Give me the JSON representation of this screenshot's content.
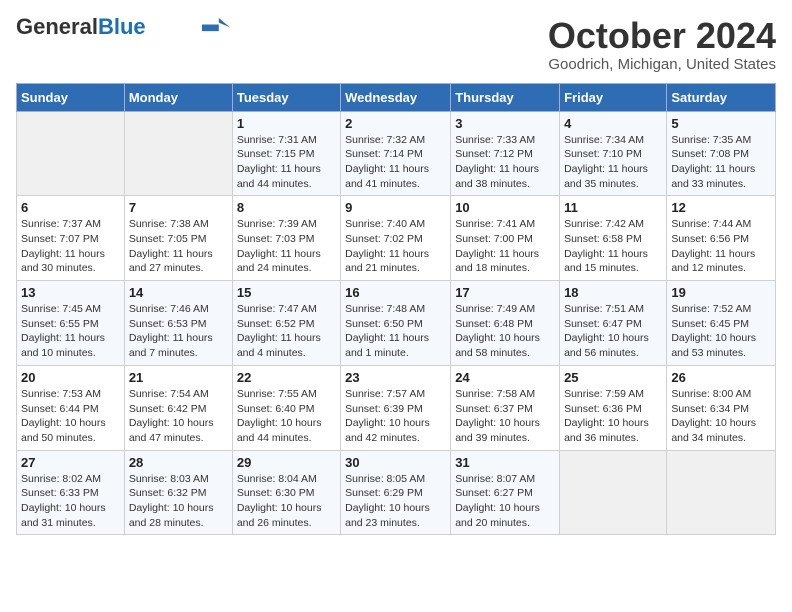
{
  "header": {
    "logo_general": "General",
    "logo_blue": "Blue",
    "main_title": "October 2024",
    "subtitle": "Goodrich, Michigan, United States"
  },
  "days_of_week": [
    "Sunday",
    "Monday",
    "Tuesday",
    "Wednesday",
    "Thursday",
    "Friday",
    "Saturday"
  ],
  "weeks": [
    [
      {
        "day": "",
        "info": ""
      },
      {
        "day": "",
        "info": ""
      },
      {
        "day": "1",
        "info": "Sunrise: 7:31 AM\nSunset: 7:15 PM\nDaylight: 11 hours and 44 minutes."
      },
      {
        "day": "2",
        "info": "Sunrise: 7:32 AM\nSunset: 7:14 PM\nDaylight: 11 hours and 41 minutes."
      },
      {
        "day": "3",
        "info": "Sunrise: 7:33 AM\nSunset: 7:12 PM\nDaylight: 11 hours and 38 minutes."
      },
      {
        "day": "4",
        "info": "Sunrise: 7:34 AM\nSunset: 7:10 PM\nDaylight: 11 hours and 35 minutes."
      },
      {
        "day": "5",
        "info": "Sunrise: 7:35 AM\nSunset: 7:08 PM\nDaylight: 11 hours and 33 minutes."
      }
    ],
    [
      {
        "day": "6",
        "info": "Sunrise: 7:37 AM\nSunset: 7:07 PM\nDaylight: 11 hours and 30 minutes."
      },
      {
        "day": "7",
        "info": "Sunrise: 7:38 AM\nSunset: 7:05 PM\nDaylight: 11 hours and 27 minutes."
      },
      {
        "day": "8",
        "info": "Sunrise: 7:39 AM\nSunset: 7:03 PM\nDaylight: 11 hours and 24 minutes."
      },
      {
        "day": "9",
        "info": "Sunrise: 7:40 AM\nSunset: 7:02 PM\nDaylight: 11 hours and 21 minutes."
      },
      {
        "day": "10",
        "info": "Sunrise: 7:41 AM\nSunset: 7:00 PM\nDaylight: 11 hours and 18 minutes."
      },
      {
        "day": "11",
        "info": "Sunrise: 7:42 AM\nSunset: 6:58 PM\nDaylight: 11 hours and 15 minutes."
      },
      {
        "day": "12",
        "info": "Sunrise: 7:44 AM\nSunset: 6:56 PM\nDaylight: 11 hours and 12 minutes."
      }
    ],
    [
      {
        "day": "13",
        "info": "Sunrise: 7:45 AM\nSunset: 6:55 PM\nDaylight: 11 hours and 10 minutes."
      },
      {
        "day": "14",
        "info": "Sunrise: 7:46 AM\nSunset: 6:53 PM\nDaylight: 11 hours and 7 minutes."
      },
      {
        "day": "15",
        "info": "Sunrise: 7:47 AM\nSunset: 6:52 PM\nDaylight: 11 hours and 4 minutes."
      },
      {
        "day": "16",
        "info": "Sunrise: 7:48 AM\nSunset: 6:50 PM\nDaylight: 11 hours and 1 minute."
      },
      {
        "day": "17",
        "info": "Sunrise: 7:49 AM\nSunset: 6:48 PM\nDaylight: 10 hours and 58 minutes."
      },
      {
        "day": "18",
        "info": "Sunrise: 7:51 AM\nSunset: 6:47 PM\nDaylight: 10 hours and 56 minutes."
      },
      {
        "day": "19",
        "info": "Sunrise: 7:52 AM\nSunset: 6:45 PM\nDaylight: 10 hours and 53 minutes."
      }
    ],
    [
      {
        "day": "20",
        "info": "Sunrise: 7:53 AM\nSunset: 6:44 PM\nDaylight: 10 hours and 50 minutes."
      },
      {
        "day": "21",
        "info": "Sunrise: 7:54 AM\nSunset: 6:42 PM\nDaylight: 10 hours and 47 minutes."
      },
      {
        "day": "22",
        "info": "Sunrise: 7:55 AM\nSunset: 6:40 PM\nDaylight: 10 hours and 44 minutes."
      },
      {
        "day": "23",
        "info": "Sunrise: 7:57 AM\nSunset: 6:39 PM\nDaylight: 10 hours and 42 minutes."
      },
      {
        "day": "24",
        "info": "Sunrise: 7:58 AM\nSunset: 6:37 PM\nDaylight: 10 hours and 39 minutes."
      },
      {
        "day": "25",
        "info": "Sunrise: 7:59 AM\nSunset: 6:36 PM\nDaylight: 10 hours and 36 minutes."
      },
      {
        "day": "26",
        "info": "Sunrise: 8:00 AM\nSunset: 6:34 PM\nDaylight: 10 hours and 34 minutes."
      }
    ],
    [
      {
        "day": "27",
        "info": "Sunrise: 8:02 AM\nSunset: 6:33 PM\nDaylight: 10 hours and 31 minutes."
      },
      {
        "day": "28",
        "info": "Sunrise: 8:03 AM\nSunset: 6:32 PM\nDaylight: 10 hours and 28 minutes."
      },
      {
        "day": "29",
        "info": "Sunrise: 8:04 AM\nSunset: 6:30 PM\nDaylight: 10 hours and 26 minutes."
      },
      {
        "day": "30",
        "info": "Sunrise: 8:05 AM\nSunset: 6:29 PM\nDaylight: 10 hours and 23 minutes."
      },
      {
        "day": "31",
        "info": "Sunrise: 8:07 AM\nSunset: 6:27 PM\nDaylight: 10 hours and 20 minutes."
      },
      {
        "day": "",
        "info": ""
      },
      {
        "day": "",
        "info": ""
      }
    ]
  ]
}
